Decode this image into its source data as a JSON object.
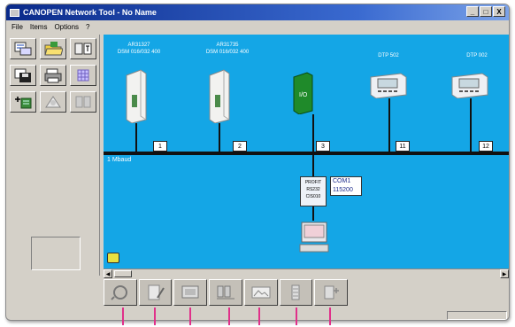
{
  "window": {
    "title": "CANOPEN Network Tool - No Name",
    "controls": [
      "_",
      "□",
      "X"
    ]
  },
  "menu": [
    "File",
    "Items",
    "Options",
    "?"
  ],
  "left_tools": [
    {
      "icon": "network-tree-icon"
    },
    {
      "icon": "open-folder-icon"
    },
    {
      "icon": "device-number-icon"
    },
    {
      "icon": "save-disk-icon"
    },
    {
      "icon": "print-icon"
    },
    {
      "icon": "grid-icon"
    },
    {
      "icon": "add-node-icon"
    },
    {
      "icon": "scan-network-icon"
    },
    {
      "icon": "device-list-icon"
    }
  ],
  "devices": [
    {
      "label": "AR31327\nDSM 016/032 400",
      "node": "1"
    },
    {
      "label": "AR31735\nDSM 016/032 400",
      "node": "2"
    },
    {
      "label": "",
      "node": "3",
      "module_text": "I/O"
    },
    {
      "label": "DTP 502",
      "node": "11"
    },
    {
      "label": "DTP 002",
      "node": "12"
    }
  ],
  "network": {
    "speed": "1 Mbaud"
  },
  "gateway": {
    "lines": [
      "PROFIT",
      "RS232",
      "CIS010"
    ]
  },
  "com_port": {
    "line1": "COM1",
    "line2": "115200"
  },
  "bottom_tools": [
    {
      "icon": "scan-icon"
    },
    {
      "icon": "edit-document-icon"
    },
    {
      "icon": "monitor-screen-icon"
    },
    {
      "icon": "network-config-icon"
    },
    {
      "icon": "image-icon"
    },
    {
      "icon": "battery-icon"
    },
    {
      "icon": "device-transfer-icon"
    }
  ],
  "colors": {
    "canvas": "#14a6e6",
    "callout": "#e0308a"
  }
}
